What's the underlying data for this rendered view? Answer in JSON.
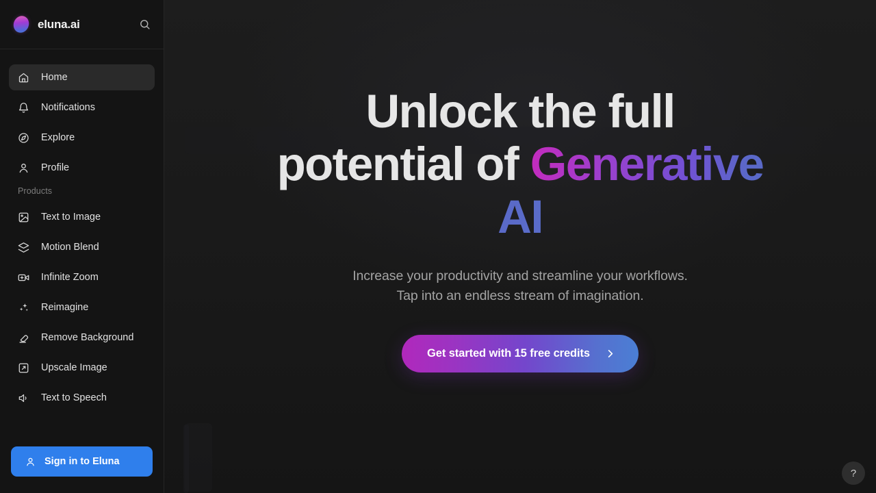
{
  "brand": {
    "name": "eluna.ai",
    "logo_icon": "eluna-gradient-ellipse-logo",
    "search_icon": "search-icon"
  },
  "sidebar": {
    "nav_items": [
      {
        "label": "Home",
        "icon": "home-icon",
        "active": true
      },
      {
        "label": "Notifications",
        "icon": "bell-icon",
        "active": false
      },
      {
        "label": "Explore",
        "icon": "compass-icon",
        "active": false
      },
      {
        "label": "Profile",
        "icon": "user-icon",
        "active": false
      }
    ],
    "products_label": "Products",
    "product_items": [
      {
        "label": "Text to Image",
        "icon": "image-icon"
      },
      {
        "label": "Motion Blend",
        "icon": "layers-icon"
      },
      {
        "label": "Infinite Zoom",
        "icon": "video-plus-icon"
      },
      {
        "label": "Reimagine",
        "icon": "sparkles-icon"
      },
      {
        "label": "Remove Background",
        "icon": "eraser-icon"
      },
      {
        "label": "Upscale Image",
        "icon": "expand-box-icon"
      },
      {
        "label": "Text to Speech",
        "icon": "speaker-icon"
      }
    ],
    "signin": {
      "label": "Sign in to Eluna",
      "icon": "user-icon",
      "color": "#2f7fec"
    }
  },
  "hero": {
    "headline_line1": "Unlock the full",
    "headline_line2_plain": "potential of ",
    "headline_gradient": "Generative AI",
    "subhead_line1": "Increase your productivity and streamline your workflows.",
    "subhead_line2": "Tap into an endless stream of imagination.",
    "cta_label": "Get started with 15 free credits",
    "cta_chevron_icon": "chevron-right-icon",
    "gradient_start": "#b128bc",
    "gradient_end": "#4a7fd4"
  },
  "help": {
    "label": "?",
    "icon": "question-mark-icon"
  }
}
